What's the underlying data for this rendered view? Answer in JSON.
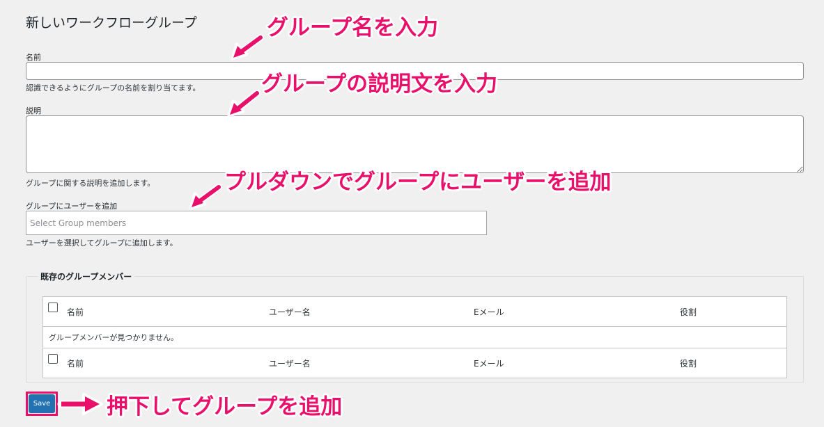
{
  "form": {
    "title": "新しいワークフローグループ",
    "name": {
      "label": "名前",
      "value": "",
      "help": "認識できるようにグループの名前を割り当てます。"
    },
    "description": {
      "label": "説明",
      "value": "",
      "help": "グループに関する説明を追加します。"
    },
    "members": {
      "label": "グループにユーザーを追加",
      "placeholder": "Select Group members",
      "help": "ユーザーを選択してグループに追加します。"
    },
    "existing": {
      "legend": "既存のグループメンバー",
      "columns": [
        "名前",
        "ユーザー名",
        "Eメール",
        "役割"
      ],
      "empty_message": "グループメンバーが見つかりません。"
    },
    "save_label": "Save"
  },
  "annotations": {
    "name": "グループ名を入力",
    "description": "グループの説明文を入力",
    "members": "プルダウンでグループにユーザーを追加",
    "save": "押下してグループを追加",
    "color": "#e8106a"
  }
}
